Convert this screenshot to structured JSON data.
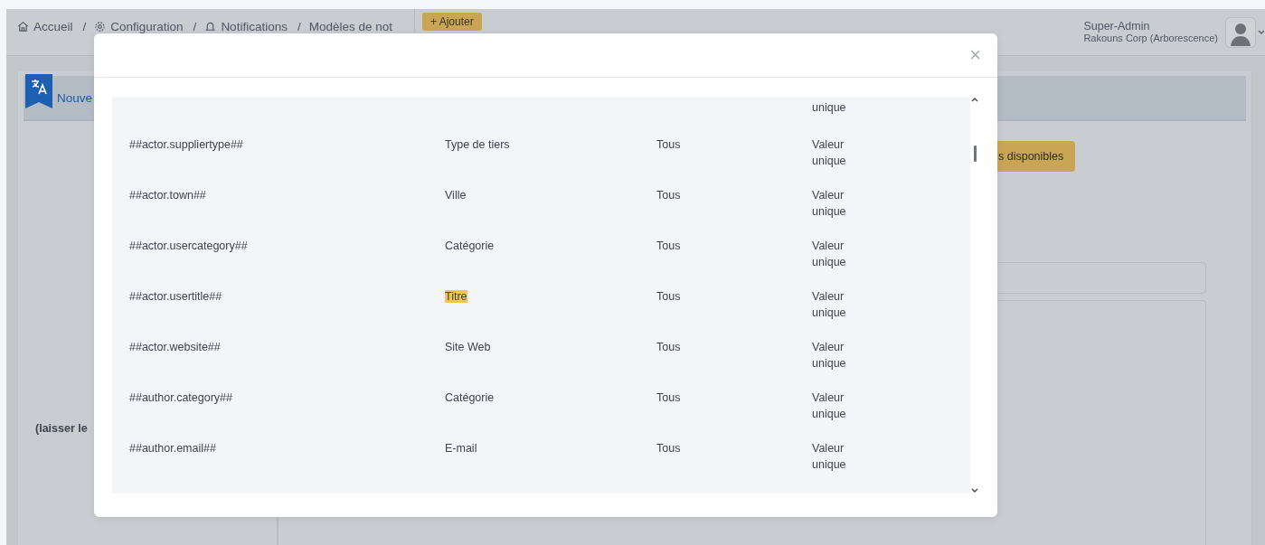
{
  "breadcrumb": [
    {
      "label": "Accueil"
    },
    {
      "separator": "/",
      "label": "Configuration"
    },
    {
      "separator": "/",
      "label": "Notifications"
    },
    {
      "separator": "/",
      "label": "Modèles de not"
    }
  ],
  "add_button": {
    "label": "+ Ajouter"
  },
  "user": {
    "name": "Super-Admin",
    "organization": "Rakouns Corp (Arborescence)"
  },
  "card": {
    "title": "Nouve",
    "action_button": "s disponibles",
    "hint": "(laisser le"
  },
  "modal": {
    "close": "×",
    "rows": [
      {
        "column_4": [
          "unique"
        ]
      },
      {
        "column_1": "##actor.suppliertype##",
        "column_2": "Type de tiers",
        "column_3": "Tous",
        "column_4": [
          "Valeur",
          "unique"
        ],
        "highlighted": false
      },
      {
        "column_1": "##actor.town##",
        "column_2": "Ville",
        "column_3": "Tous",
        "column_4": [
          "Valeur",
          "unique"
        ],
        "highlighted": false
      },
      {
        "column_1": "##actor.usercategory##",
        "column_2": "Catégorie",
        "column_3": "Tous",
        "column_4": [
          "Valeur",
          "unique"
        ],
        "highlighted": false
      },
      {
        "column_1": "##actor.usertitle##",
        "column_2": "Titre",
        "column_3": "Tous",
        "column_4": [
          "Valeur",
          "unique"
        ],
        "highlighted": true
      },
      {
        "column_1": "##actor.website##",
        "column_2": "Site Web",
        "column_3": "Tous",
        "column_4": [
          "Valeur",
          "unique"
        ],
        "highlighted": false
      },
      {
        "column_1": "##author.category##",
        "column_2": "Catégorie",
        "column_3": "Tous",
        "column_4": [
          "Valeur",
          "unique"
        ],
        "highlighted": false
      },
      {
        "column_1": "##author.email##",
        "column_2": "E-mail",
        "column_3": "Tous",
        "column_4": [
          "Valeur",
          "unique"
        ],
        "highlighted": false
      }
    ]
  }
}
